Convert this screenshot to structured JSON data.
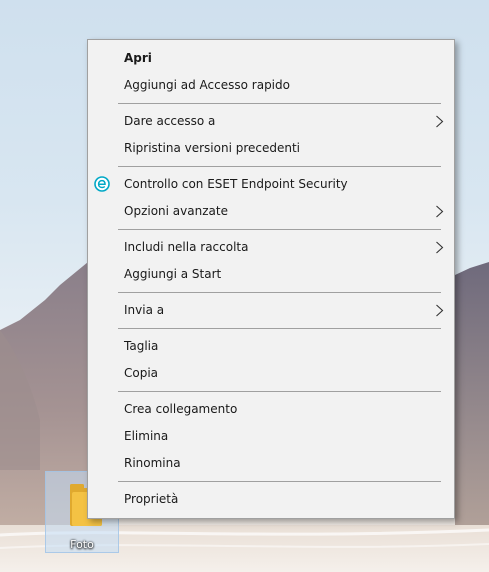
{
  "desktop": {
    "icon_label": "Foto"
  },
  "menu": {
    "items": [
      {
        "label": "Apri"
      },
      {
        "label": "Aggiungi ad Accesso rapido"
      },
      {
        "label": "Dare accesso a"
      },
      {
        "label": "Ripristina versioni precedenti"
      },
      {
        "label": "Controllo con ESET Endpoint Security"
      },
      {
        "label": "Opzioni avanzate"
      },
      {
        "label": "Includi nella raccolta"
      },
      {
        "label": "Aggiungi a Start"
      },
      {
        "label": "Invia a"
      },
      {
        "label": "Taglia"
      },
      {
        "label": "Copia"
      },
      {
        "label": "Crea collegamento"
      },
      {
        "label": "Elimina"
      },
      {
        "label": "Rinomina"
      },
      {
        "label": "Proprietà"
      }
    ]
  },
  "colors": {
    "menu_background": "#f2f2f2",
    "menu_border": "#a0a0a0",
    "eset_accent": "#00a8c6",
    "folder_yellow": "#f4c244"
  }
}
